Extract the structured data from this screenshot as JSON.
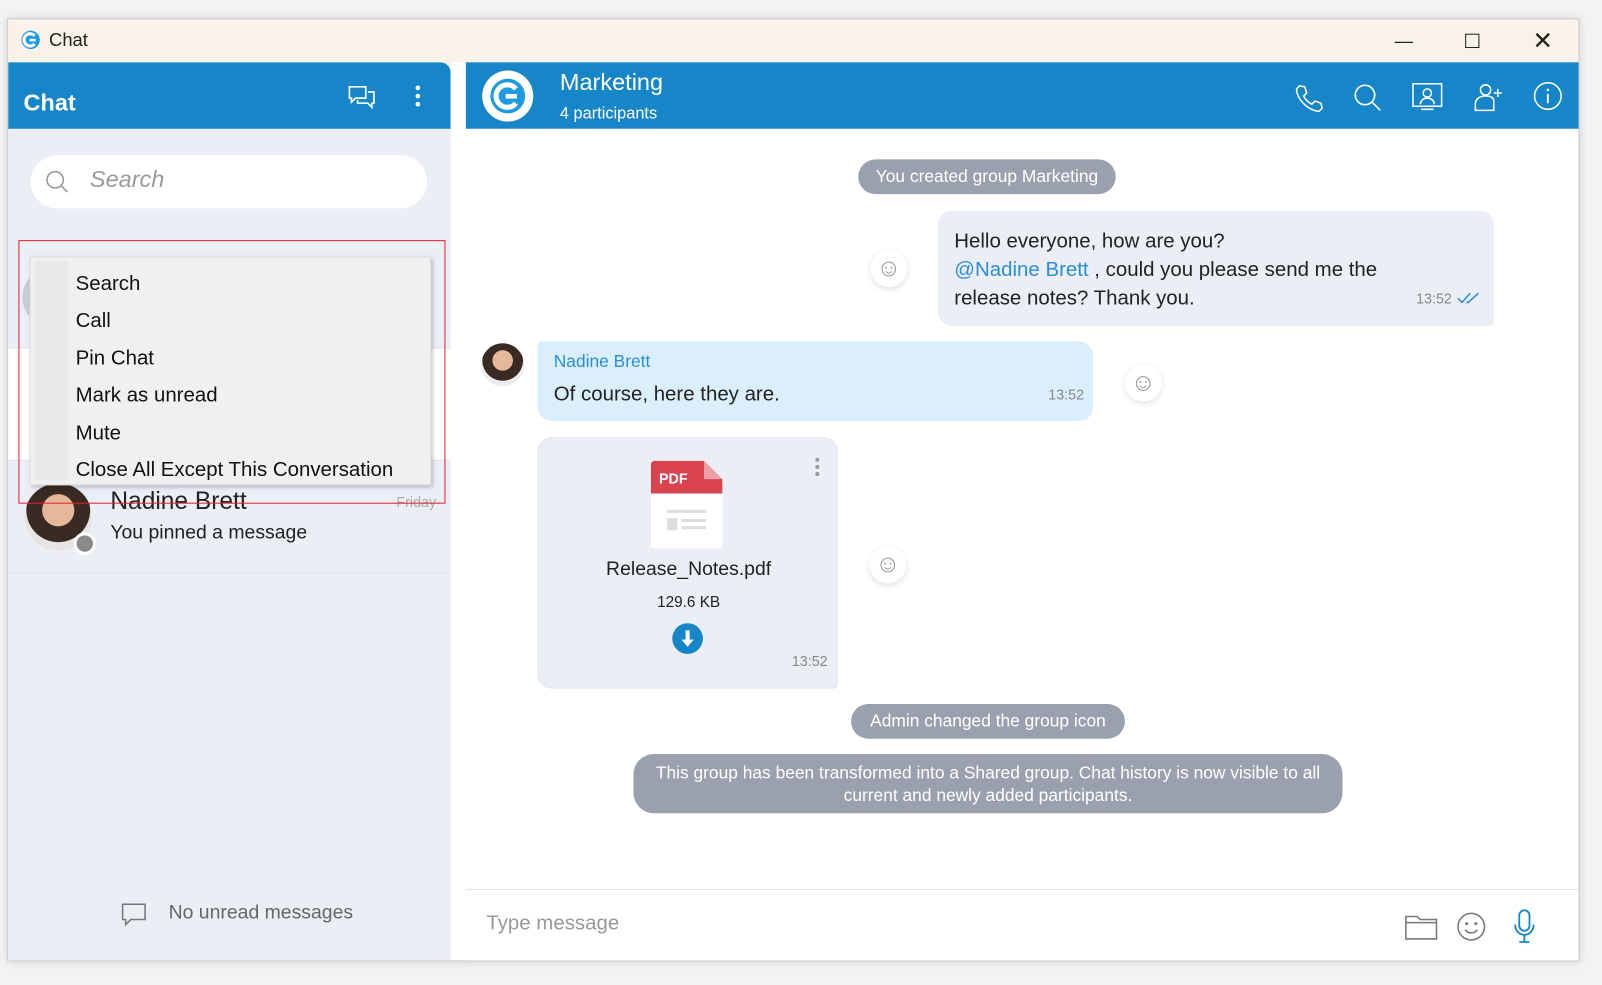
{
  "window": {
    "title": "Chat",
    "controls": [
      "minimize",
      "maximize",
      "close"
    ]
  },
  "sidebar": {
    "title": "Chat",
    "search_placeholder": "Search",
    "context_menu": [
      "Search",
      "Call",
      "Pin Chat",
      "Mark as unread",
      "Mute",
      "Close All Except This Conversation"
    ],
    "conversations": [
      {
        "name": "Nadine Brett",
        "preview": "You pinned a message",
        "time": "Friday",
        "status": "offline"
      }
    ],
    "footer": "No unread messages"
  },
  "chat": {
    "title": "Marketing",
    "subtitle": "4 participants",
    "header_icons": [
      "phone-icon",
      "search-icon",
      "contact-card-icon",
      "add-participant-icon",
      "info-icon"
    ],
    "events": {
      "created": "You created group Marketing",
      "icon_changed": "Admin changed the group icon",
      "shared": "This group has been transformed into a Shared group. Chat history is now visible to all current and newly added participants."
    },
    "messages": [
      {
        "direction": "out",
        "line1": "Hello everyone, how are you?",
        "mention": "@Nadine Brett",
        "line2": " , could you please send me the",
        "line3": "release notes? Thank you.",
        "time": "13:52"
      },
      {
        "direction": "in",
        "sender": "Nadine Brett",
        "text": "Of course, here they are.",
        "time": "13:52"
      },
      {
        "direction": "in",
        "file": {
          "badge": "PDF",
          "name": "Release_Notes.pdf",
          "size": "129.6 KB"
        },
        "time": "13:52"
      }
    ],
    "composer_placeholder": "Type message"
  },
  "colors": {
    "accent": "#1686c8",
    "mention": "#2a8fd4",
    "highlight": "#e8202a",
    "incoming": "#dbeefd",
    "outgoing": "#ebeef5",
    "pdf": "#d9434f"
  }
}
